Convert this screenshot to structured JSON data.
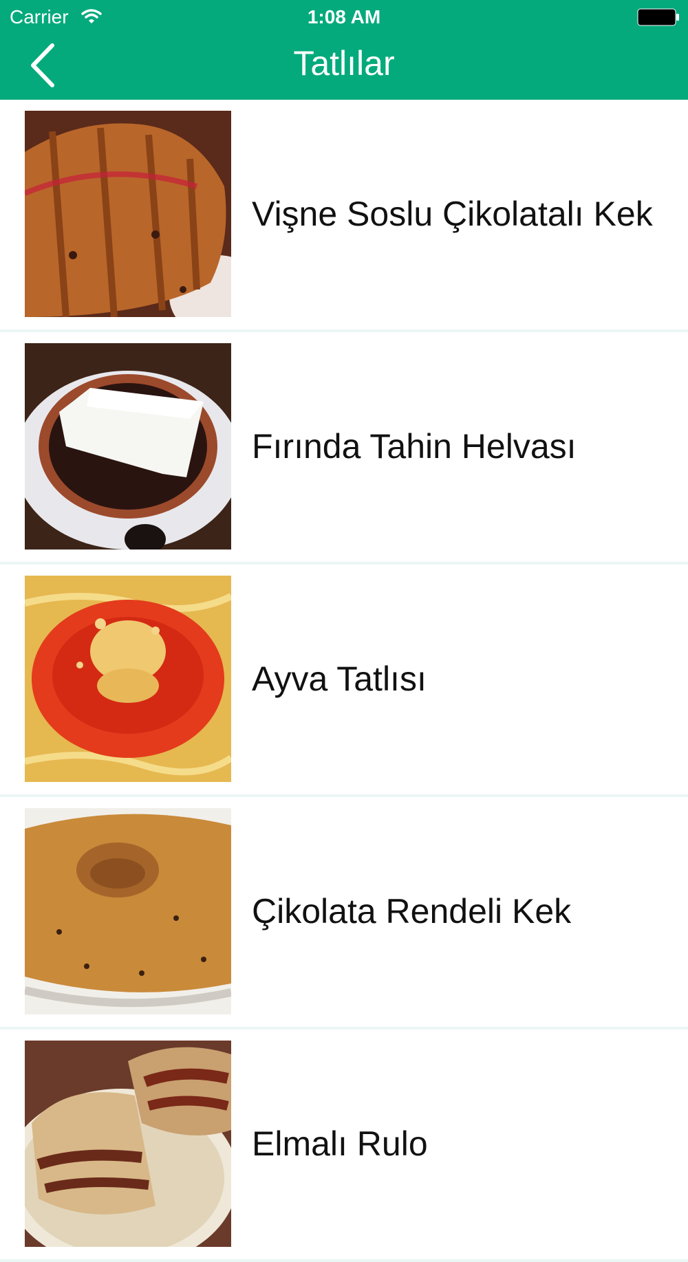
{
  "status_bar": {
    "carrier": "Carrier",
    "time": "1:08 AM"
  },
  "nav": {
    "title": "Tatlılar",
    "back_icon": "chevron-left-icon"
  },
  "colors": {
    "accent": "#04aa7c",
    "separator": "#eaf6f4",
    "text": "#111111"
  },
  "items": [
    {
      "label": "Vişne Soslu Çikolatalı Kek"
    },
    {
      "label": "Fırında Tahin Helvası"
    },
    {
      "label": "Ayva Tatlısı"
    },
    {
      "label": "Çikolata Rendeli Kek"
    },
    {
      "label": "Elmalı Rulo"
    }
  ]
}
